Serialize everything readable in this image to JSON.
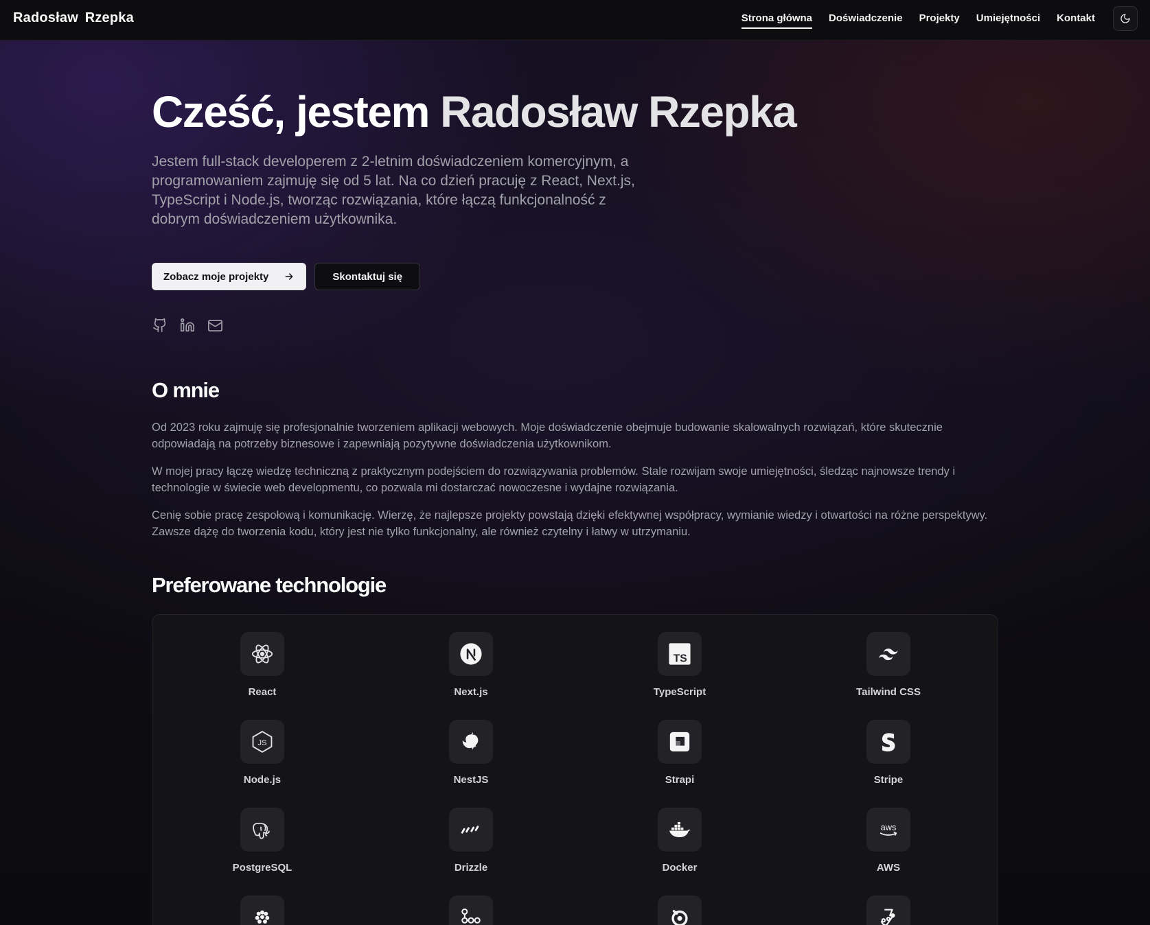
{
  "nav": {
    "brand": "Radosław Rzepka",
    "links": [
      "Strona główna",
      "Doświadczenie",
      "Projekty",
      "Umiejętności",
      "Kontakt"
    ],
    "active_index": 0,
    "theme_toggle_icon": "moon-icon"
  },
  "hero": {
    "title_greeting": "Cześć, jestem",
    "title_name": "Radosław Rzepka",
    "description": "Jestem full-stack developerem z 2-letnim doświadczeniem komercyjnym, a programowaniem zajmuję się od 5 lat. Na co dzień pracuję z React, Next.js, TypeScript i Node.js, tworząc rozwiązania, które łączą funkcjonalność z dobrym doświadczeniem użytkownika.",
    "primary_button": "Zobacz moje projekty",
    "secondary_button": "Skontaktuj się",
    "socials": [
      "github-icon",
      "linkedin-icon",
      "mail-icon"
    ]
  },
  "about": {
    "title": "O mnie",
    "paragraphs": [
      "Od 2023 roku zajmuję się profesjonalnie tworzeniem aplikacji webowych. Moje doświadczenie obejmuje budowanie skalowalnych rozwiązań, które skutecznie odpowiadają na potrzeby biznesowe i zapewniają pozytywne doświadczenia użytkownikom.",
      "W mojej pracy łączę wiedzę techniczną z praktycznym podejściem do rozwiązywania problemów. Stale rozwijam swoje umiejętności, śledząc najnowsze trendy i technologie w świecie web developmentu, co pozwala mi dostarczać nowoczesne i wydajne rozwiązania.",
      "Cenię sobie pracę zespołową i komunikację. Wierzę, że najlepsze projekty powstają dzięki efektywnej współpracy, wymianie wiedzy i otwartości na różne perspektywy. Zawsze dążę do tworzenia kodu, który jest nie tylko funkcjonalny, ale również czytelny i łatwy w utrzymaniu."
    ]
  },
  "tech": {
    "title": "Preferowane technologie",
    "items": [
      {
        "label": "React",
        "icon": "react-icon"
      },
      {
        "label": "Next.js",
        "icon": "nextjs-icon"
      },
      {
        "label": "TypeScript",
        "icon": "typescript-icon"
      },
      {
        "label": "Tailwind CSS",
        "icon": "tailwind-icon"
      },
      {
        "label": "Node.js",
        "icon": "nodejs-icon"
      },
      {
        "label": "NestJS",
        "icon": "nestjs-icon"
      },
      {
        "label": "Strapi",
        "icon": "strapi-icon"
      },
      {
        "label": "Stripe",
        "icon": "stripe-icon"
      },
      {
        "label": "PostgreSQL",
        "icon": "postgresql-icon"
      },
      {
        "label": "Drizzle",
        "icon": "drizzle-icon"
      },
      {
        "label": "Docker",
        "icon": "docker-icon"
      },
      {
        "label": "AWS",
        "icon": "aws-icon"
      },
      {
        "label": "",
        "icon": "raspberry-icon"
      },
      {
        "label": "",
        "icon": "graph-icon"
      },
      {
        "label": "",
        "icon": "ring-icon"
      },
      {
        "label": "",
        "icon": "jest-icon"
      }
    ],
    "aws_text": "aws",
    "ts_text": "TS",
    "js_text": "JS"
  }
}
